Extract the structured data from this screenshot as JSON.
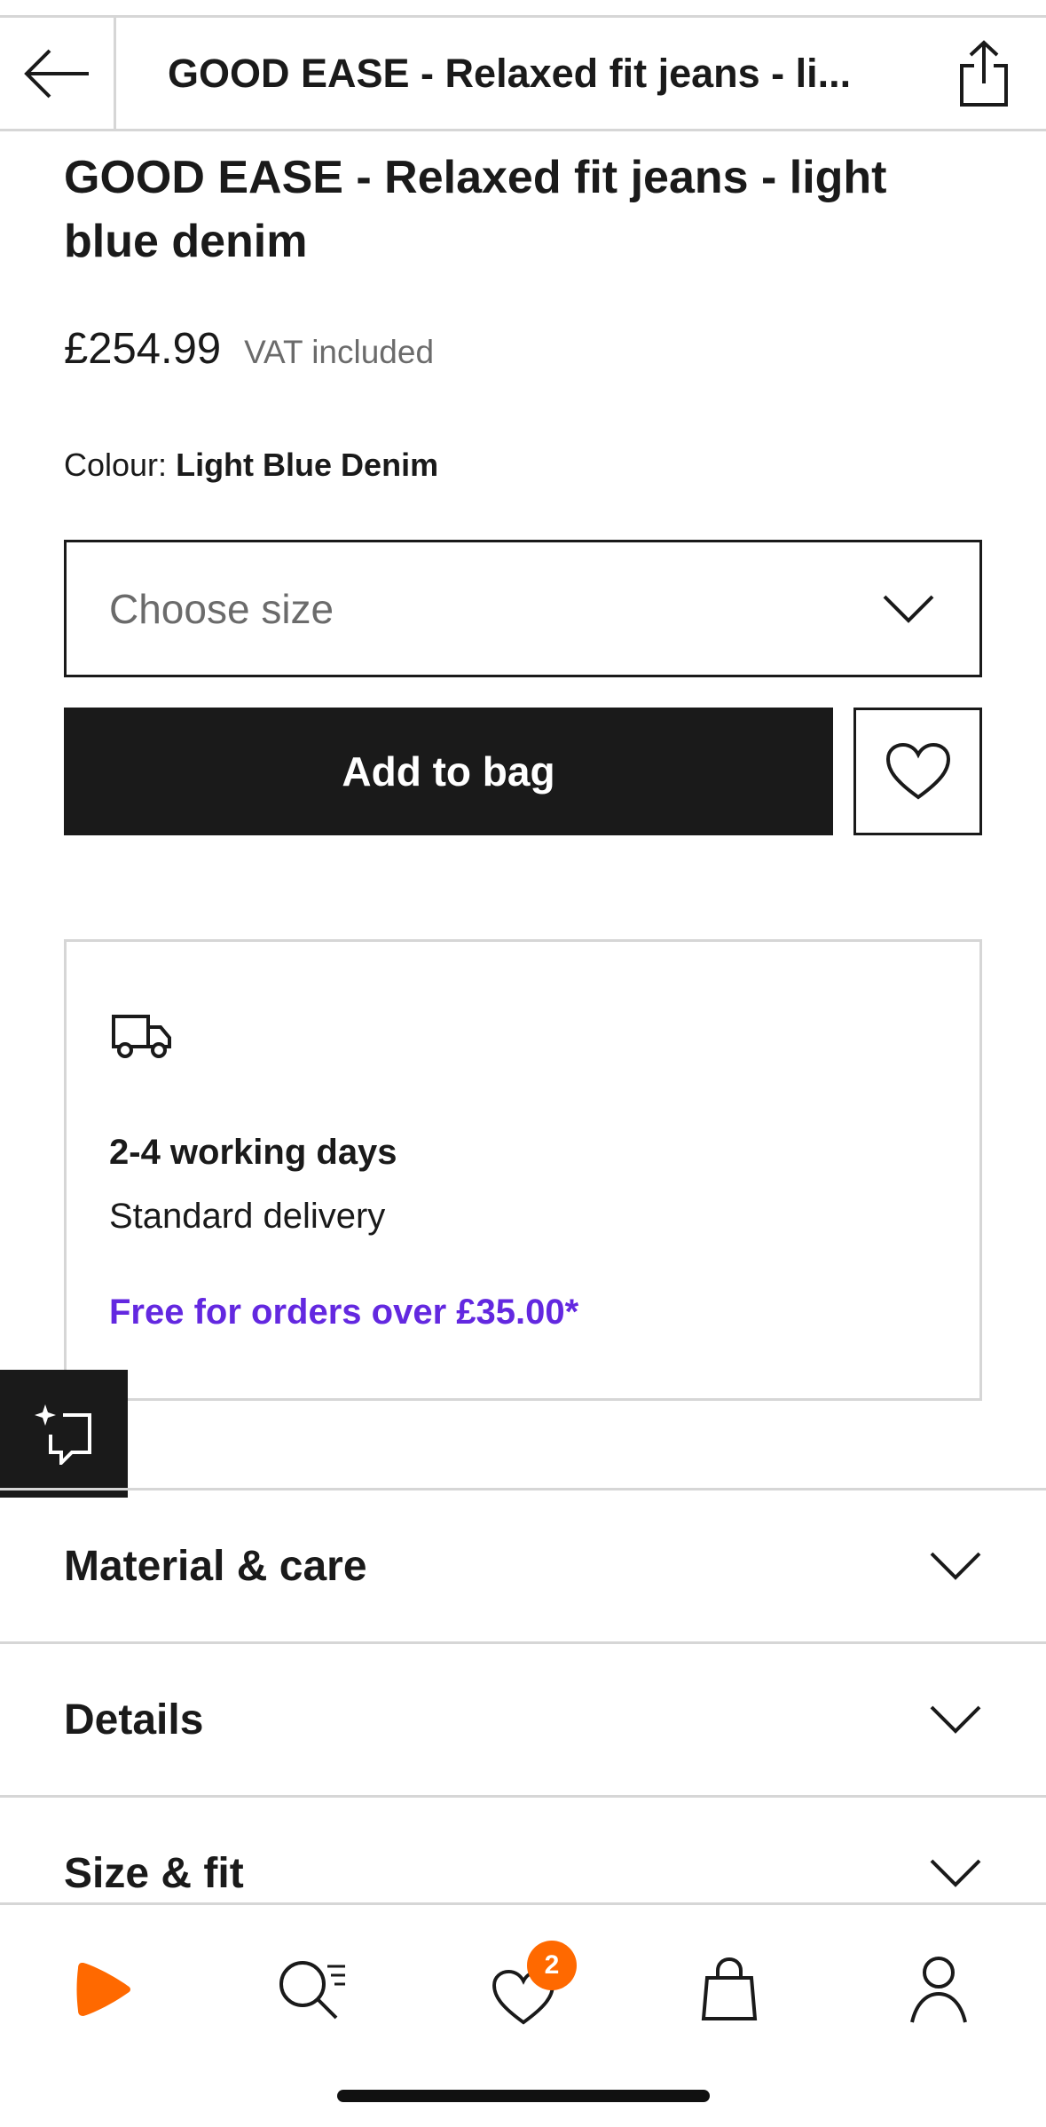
{
  "header": {
    "title": "GOOD EASE - Relaxed fit jeans - li..."
  },
  "product": {
    "title": "GOOD EASE - Relaxed fit jeans - light blue denim",
    "price": "£254.99",
    "vat": "VAT included",
    "colour_label": "Colour:",
    "colour_value": "Light Blue Denim"
  },
  "size_select": {
    "placeholder": "Choose size"
  },
  "actions": {
    "add_to_bag": "Add to bag"
  },
  "delivery": {
    "time": "2-4 working days",
    "type": "Standard delivery",
    "free_offer": "Free for orders over £35.00*"
  },
  "accordion": [
    {
      "label": "Material & care"
    },
    {
      "label": "Details"
    },
    {
      "label": "Size & fit"
    }
  ],
  "bottom_nav": {
    "wishlist_count": "2"
  },
  "colors": {
    "accent_orange": "#ff6900",
    "promo_purple": "#6328e0",
    "primary_dark": "#1a1a1a"
  }
}
